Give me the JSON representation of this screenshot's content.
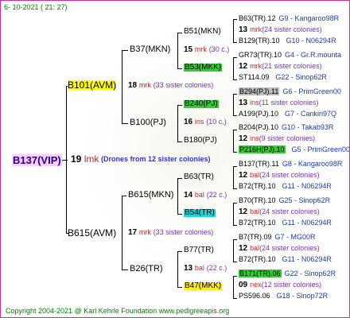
{
  "header": {
    "date": "6- 10-2021 ( 21: 27)"
  },
  "footer": {
    "copyright": "Copyright 2004-2021 @ Karl Kehrle Foundation   www.pedigreeapis.org"
  },
  "root": {
    "name": "B137(VIP)",
    "num": "19",
    "unit": "lmk",
    "note": "(Drones from 12 sister colonies)"
  },
  "gen1": {
    "top": {
      "name": "B101(AVM)",
      "num": "18",
      "unit": "mrk",
      "note": "(33 sister colonies)"
    },
    "bottom": {
      "name": "B615(AVM)",
      "num": "17",
      "unit": "mrk",
      "note": "(33 sister colonies)"
    }
  },
  "gen2": {
    "a": {
      "name": "B37(MKN)"
    },
    "b": {
      "name": "B100(PJ)",
      "num": "16",
      "unit": "ins",
      "note": "(10 c.)"
    },
    "c": {
      "name": "B615(MKN)",
      "num": "14",
      "unit": "bal",
      "note": "(22 c.)"
    },
    "d": {
      "name": "B26(TR)",
      "num": "13",
      "unit": "bal",
      "note": "(22 c.)"
    }
  },
  "gen3": {
    "a1": {
      "name": "B51(MKN)",
      "num": "15",
      "unit": "mrk",
      "note": "(30 c.)"
    },
    "a2": {
      "name": "B53(MKK)",
      "hl": "#33cc33"
    },
    "b1": {
      "name": "B240(PJ)",
      "hl": "#33cc33"
    },
    "b2": {
      "name": "B180(PJ)"
    },
    "c1": {
      "name": "B63(TR)"
    },
    "c2": {
      "name": "B54(TR)",
      "hl": "#22d3d8"
    },
    "d1": {
      "name": "B77(TR)"
    },
    "d2": {
      "name": "B47(MKK)",
      "hl": "#ffee22"
    }
  },
  "gen4": [
    {
      "top": "B63(TR).12",
      "topTail": "G9 - Kangaroo98R",
      "num": "13",
      "unit": "mrk",
      "note": "(24 sister colonies)",
      "bot": "B129(TR).10",
      "botTail": "G10 - N06294R"
    },
    {
      "top": "GR73(TR).10",
      "topTail": "G4 - Gr.R.mounta",
      "num": "12",
      "unit": "mrk",
      "note": "(21 sister colonies)",
      "bot": "ST114.09",
      "botTail": "G22 - Sinop62R"
    },
    {
      "top": "B294(PJ).11",
      "topTail": "G6 - PrimGreen00",
      "topHl": "#bbbbbb",
      "num": "13",
      "unit": "ins",
      "note": "(11 sister colonies)",
      "bot": "A199(PJ).10",
      "botTail": "G7 - Cankiri97Q"
    },
    {
      "top": "B204(PJ).10",
      "topTail": "G10 - Takab93R",
      "num": "12",
      "unit": "ins",
      "note": "(9 sister colonies)",
      "bot": "P216H(PJ).10",
      "botTail": "G5 - PrimGreen00",
      "botHl": "#33cc33"
    },
    {
      "top": "B137(TR).11",
      "topTail": "G8 - Kangaroo98R",
      "num": "12",
      "unit": "bal",
      "note": "(24 sister colonies)",
      "bot": "B72(TR).10",
      "botTail": "G11 - N06294R"
    },
    {
      "top": "B70(TR).10",
      "topTail": "G25 - Sinop62R",
      "num": "12",
      "unit": "bal",
      "note": "(24 sister colonies)",
      "bot": "B72(TR).10",
      "botTail": "G11 - N06294R"
    },
    {
      "top": "B7(TR).09",
      "topTail": "G7 - MG00R",
      "num": "12",
      "unit": "bal",
      "note": "(24 sister colonies)",
      "bot": "B72(TR).10",
      "botTail": "G11 - N06294R"
    },
    {
      "top": "B171(TR).06",
      "topTail": "G22 - Sinop62R",
      "topHl": "#33cc33",
      "num": "09",
      "unit": "nex",
      "note": "(12 sister colonies)",
      "bot": "PS596.06",
      "botTail": "G18 - Sinop72R"
    }
  ]
}
